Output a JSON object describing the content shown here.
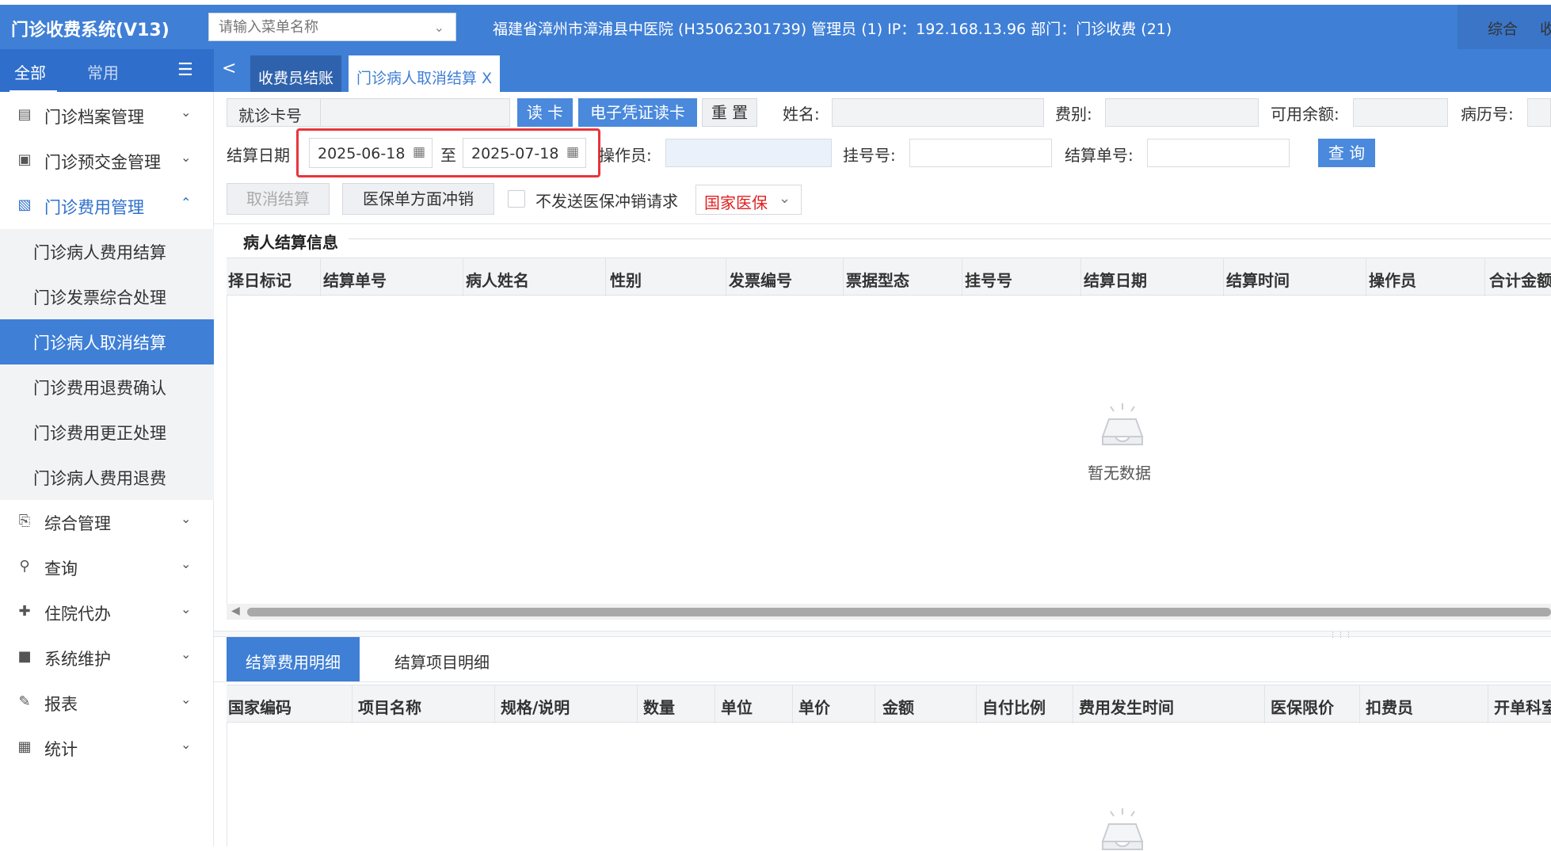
{
  "header": {
    "app_title": "门诊收费系统(V13)",
    "menu_search_placeholder": "请输入菜单名称",
    "hospital_info": "福建省漳州市漳浦县中医院 (H35062301739) 管理员 (1) IP：192.168.13.96 部门：门诊收费 (21)",
    "right_links": [
      "综合",
      "收"
    ]
  },
  "sidebar": {
    "tabs": [
      "全部",
      "常用"
    ],
    "items": [
      {
        "label": "门诊档案管理",
        "icon": "document-icon",
        "expanded": false
      },
      {
        "label": "门诊预交金管理",
        "icon": "wallet-icon",
        "expanded": false
      },
      {
        "label": "门诊费用管理",
        "icon": "receipt-icon",
        "expanded": true,
        "children": [
          "门诊病人费用结算",
          "门诊发票综合处理",
          "门诊病人取消结算",
          "门诊费用退费确认",
          "门诊费用更正处理",
          "门诊病人费用退费"
        ],
        "active_child": "门诊病人取消结算"
      },
      {
        "label": "综合管理",
        "icon": "printer-icon",
        "expanded": false
      },
      {
        "label": "查询",
        "icon": "search-icon",
        "expanded": false
      },
      {
        "label": "住院代办",
        "icon": "hospital-icon",
        "expanded": false
      },
      {
        "label": "系统维护",
        "icon": "monitor-icon",
        "expanded": false
      },
      {
        "label": "报表",
        "icon": "report-icon",
        "expanded": false
      },
      {
        "label": "统计",
        "icon": "chart-icon",
        "expanded": false
      }
    ]
  },
  "tabs": {
    "back": "<",
    "items": [
      {
        "label": "收费员结账",
        "active": false
      },
      {
        "label": "门诊病人取消结算",
        "active": true,
        "close": "X"
      }
    ]
  },
  "form": {
    "card_no_label": "就诊卡号",
    "read_card_button": "读 卡",
    "e_voucher_button": "电子凭证读卡",
    "reset_button": "重 置",
    "name_label": "姓名:",
    "fee_type_label": "费别:",
    "balance_label": "可用余额:",
    "record_no_label": "病历号:",
    "settle_date_label": "结算日期",
    "date_from": "2025-06-18",
    "date_to_sep": "至",
    "date_to": "2025-07-18",
    "operator_label": "操作员:",
    "reg_no_label": "挂号号:",
    "settle_no_label": "结算单号:",
    "query_button": "查 询",
    "cancel_settle_button": "取消结算",
    "insurance_reverse_button": "医保单方面冲销",
    "no_send_checkbox_label": "不发送医保冲销请求",
    "insurance_select": "国家医保"
  },
  "settle_section": {
    "title": "病人结算信息",
    "columns": [
      "择日标记",
      "结算单号",
      "病人姓名",
      "性别",
      "发票编号",
      "票据型态",
      "挂号号",
      "结算日期",
      "结算时间",
      "操作员",
      "合计金额"
    ],
    "rows": [],
    "empty_text": "暂无数据"
  },
  "detail_section": {
    "tabs": [
      "结算费用明细",
      "结算项目明细"
    ],
    "columns": [
      "国家编码",
      "项目名称",
      "规格/说明",
      "数量",
      "单位",
      "单价",
      "金额",
      "自付比例",
      "费用发生时间",
      "医保限价",
      "扣费员",
      "开单科室"
    ],
    "rows": []
  },
  "colors": {
    "primary": "#3f7fd6",
    "sidebar_tab_bg": "#2f6fcb",
    "highlight": "#e8353c",
    "insurance_text": "#e02020"
  }
}
